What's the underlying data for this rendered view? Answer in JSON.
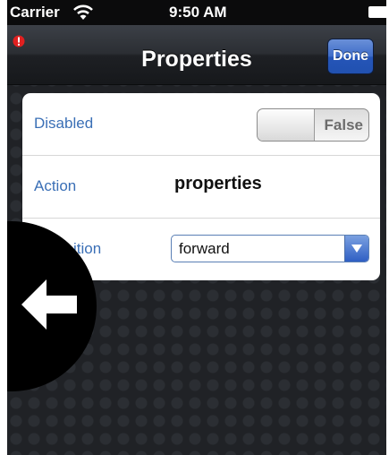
{
  "status_bar": {
    "carrier": "Carrier",
    "time": "9:50 AM",
    "wifi_icon": "wifi-icon",
    "battery_icon": "battery-icon"
  },
  "nav_bar": {
    "title": "Properties",
    "done_label": "Done",
    "alert_icon": "alert-icon",
    "done_color": "#3a68c4"
  },
  "properties": {
    "disabled": {
      "label": "Disabled",
      "value": "False"
    },
    "action": {
      "label": "Action",
      "value": "properties"
    },
    "transition": {
      "label": "Transition",
      "value": "forward",
      "visible_label": "ition"
    }
  },
  "back_button": {
    "icon": "left-arrow-icon"
  }
}
